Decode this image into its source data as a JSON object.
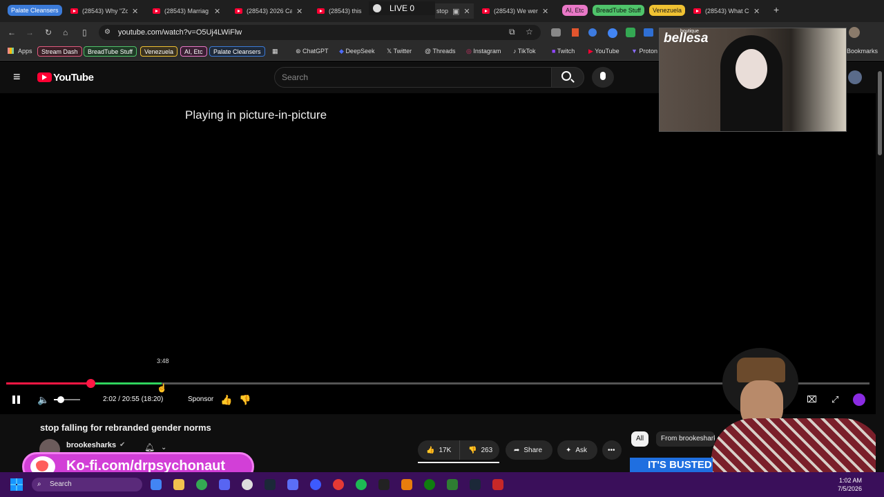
{
  "browser": {
    "tab_groups": [
      "Palate Cleansers",
      "AI, Etc",
      "BreadTube Stuff",
      "Venezuela"
    ],
    "tabs": [
      "(28543) Why \"Zo",
      "(28543) Marriag",
      "(28543) 2026 Ca",
      "(28543) this",
      "(28543) We wer",
      "(28543) What Co"
    ],
    "partial_tab_label": "stop",
    "new_tab": "+",
    "live_label": "LIVE",
    "live_count": "0",
    "url": "youtube.com/watch?v=O5Uj4LWiFlw",
    "bookmarks": {
      "apps": "Apps",
      "chips": [
        "Stream Dash",
        "BreadTube Stuff",
        "Venezuela",
        "AI, Etc",
        "Palate Cleansers"
      ],
      "links": [
        "ChatGPT",
        "DeepSeek",
        "Twitter",
        "Threads",
        "Instagram",
        "TikTok",
        "Twitch",
        "YouTube",
        "Proton"
      ],
      "all_bookmarks": "Bookmarks"
    }
  },
  "youtube": {
    "logo": "YouTube",
    "search_placeholder": "Search",
    "player": {
      "pip_message": "Playing in picture-in-picture",
      "hover_time": "3:48",
      "time_display": "2:02 / 20:55 (18:20)",
      "sponsor_label": "Sponsor",
      "played_fraction": 0.0975,
      "buffered_fraction": 0.18,
      "volume_fraction": 0.25
    },
    "video": {
      "title": "stop falling for rebranded gender norms",
      "channel": "brookesharks",
      "likes": "17K",
      "dislikes": "263",
      "share": "Share",
      "ask": "Ask"
    },
    "filters": [
      "All",
      "From brookesharks"
    ]
  },
  "overlays": {
    "pip_brand": "bellesa",
    "pip_brand_sub": "boutique",
    "kofi": "Ko-fi.com/drpsychonaut",
    "thumb_text": "IT'S BUSTED"
  },
  "taskbar": {
    "search": "Search",
    "time": "1:02 AM",
    "date": "7/5/2026"
  },
  "colors": {
    "progress_played": "#ff1744",
    "progress_buffer": "#2fd45e",
    "kofi": "#d23fd7",
    "taskbar": "#3a0f5a"
  }
}
